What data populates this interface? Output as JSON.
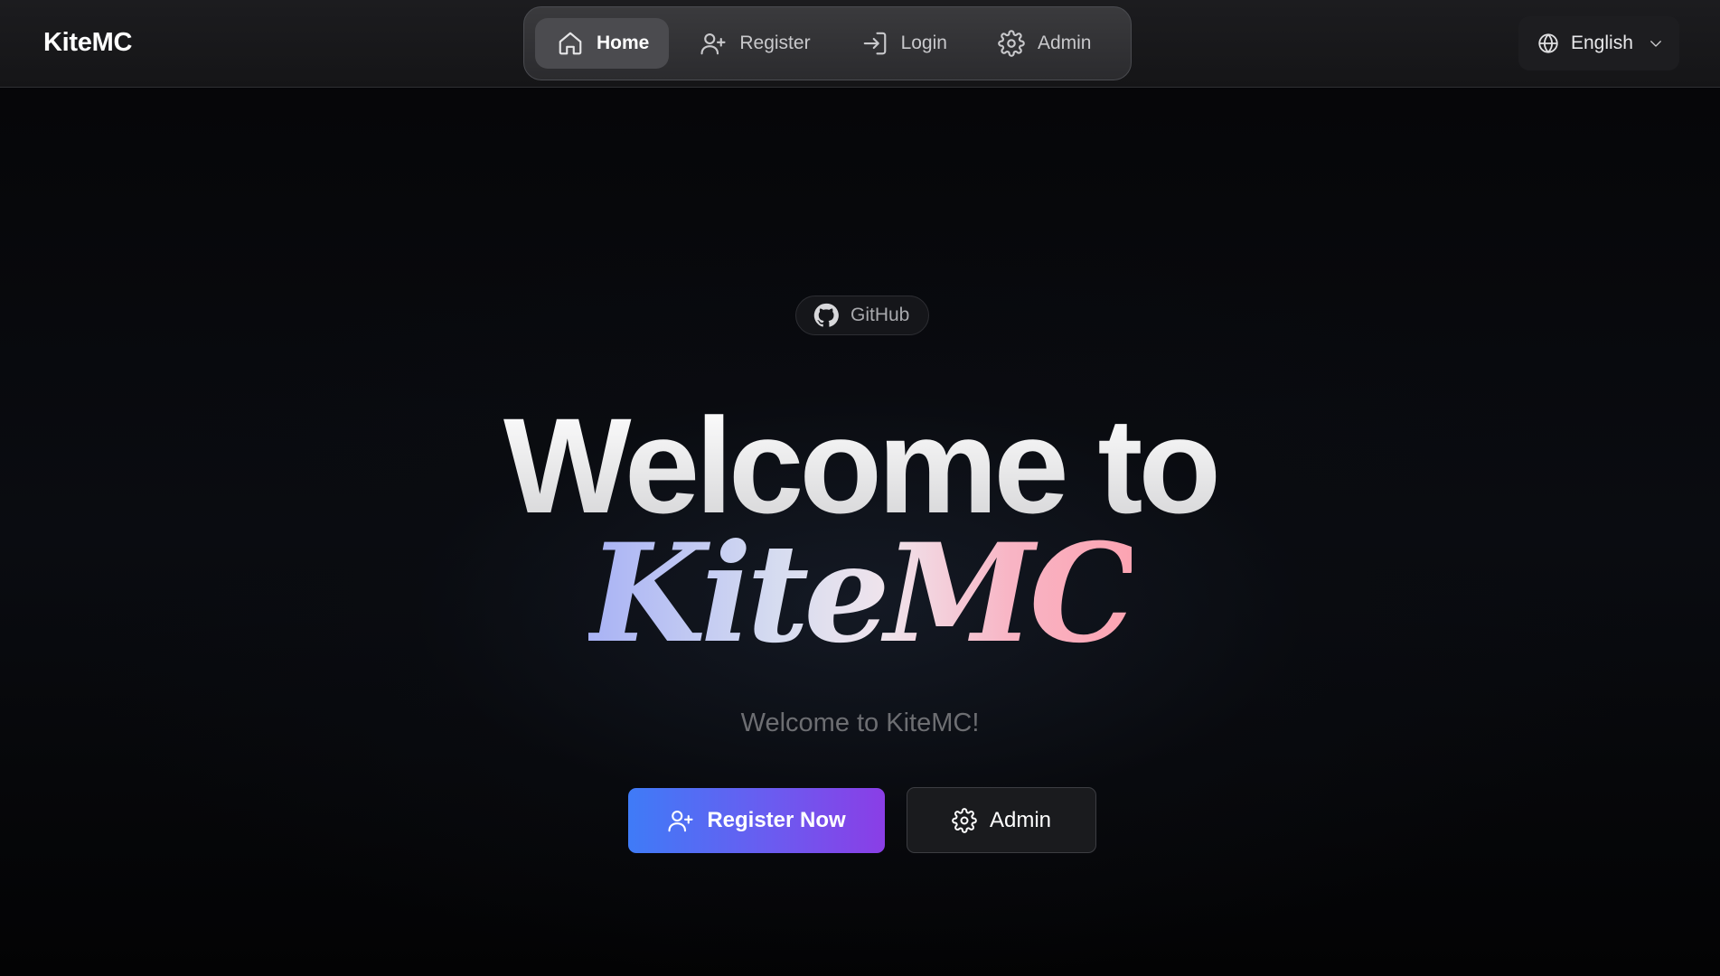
{
  "header": {
    "logo": "KiteMC",
    "nav": [
      {
        "label": "Home",
        "icon": "home-icon",
        "active": true
      },
      {
        "label": "Register",
        "icon": "user-plus-icon",
        "active": false
      },
      {
        "label": "Login",
        "icon": "login-icon",
        "active": false
      },
      {
        "label": "Admin",
        "icon": "gear-icon",
        "active": false
      }
    ],
    "language": {
      "label": "English",
      "icon": "globe-icon"
    }
  },
  "hero": {
    "github_label": "GitHub",
    "title_line1": "Welcome to",
    "title_line2": "KiteMC",
    "subtitle": "Welcome to KiteMC!",
    "primary_button": "Register Now",
    "secondary_button": "Admin"
  },
  "colors": {
    "accent_start": "#3f7bf7",
    "accent_end": "#8a3ee6",
    "gradient_text_start": "#a8b2f5",
    "gradient_text_end": "#fca4b2",
    "background": "#07080b"
  }
}
